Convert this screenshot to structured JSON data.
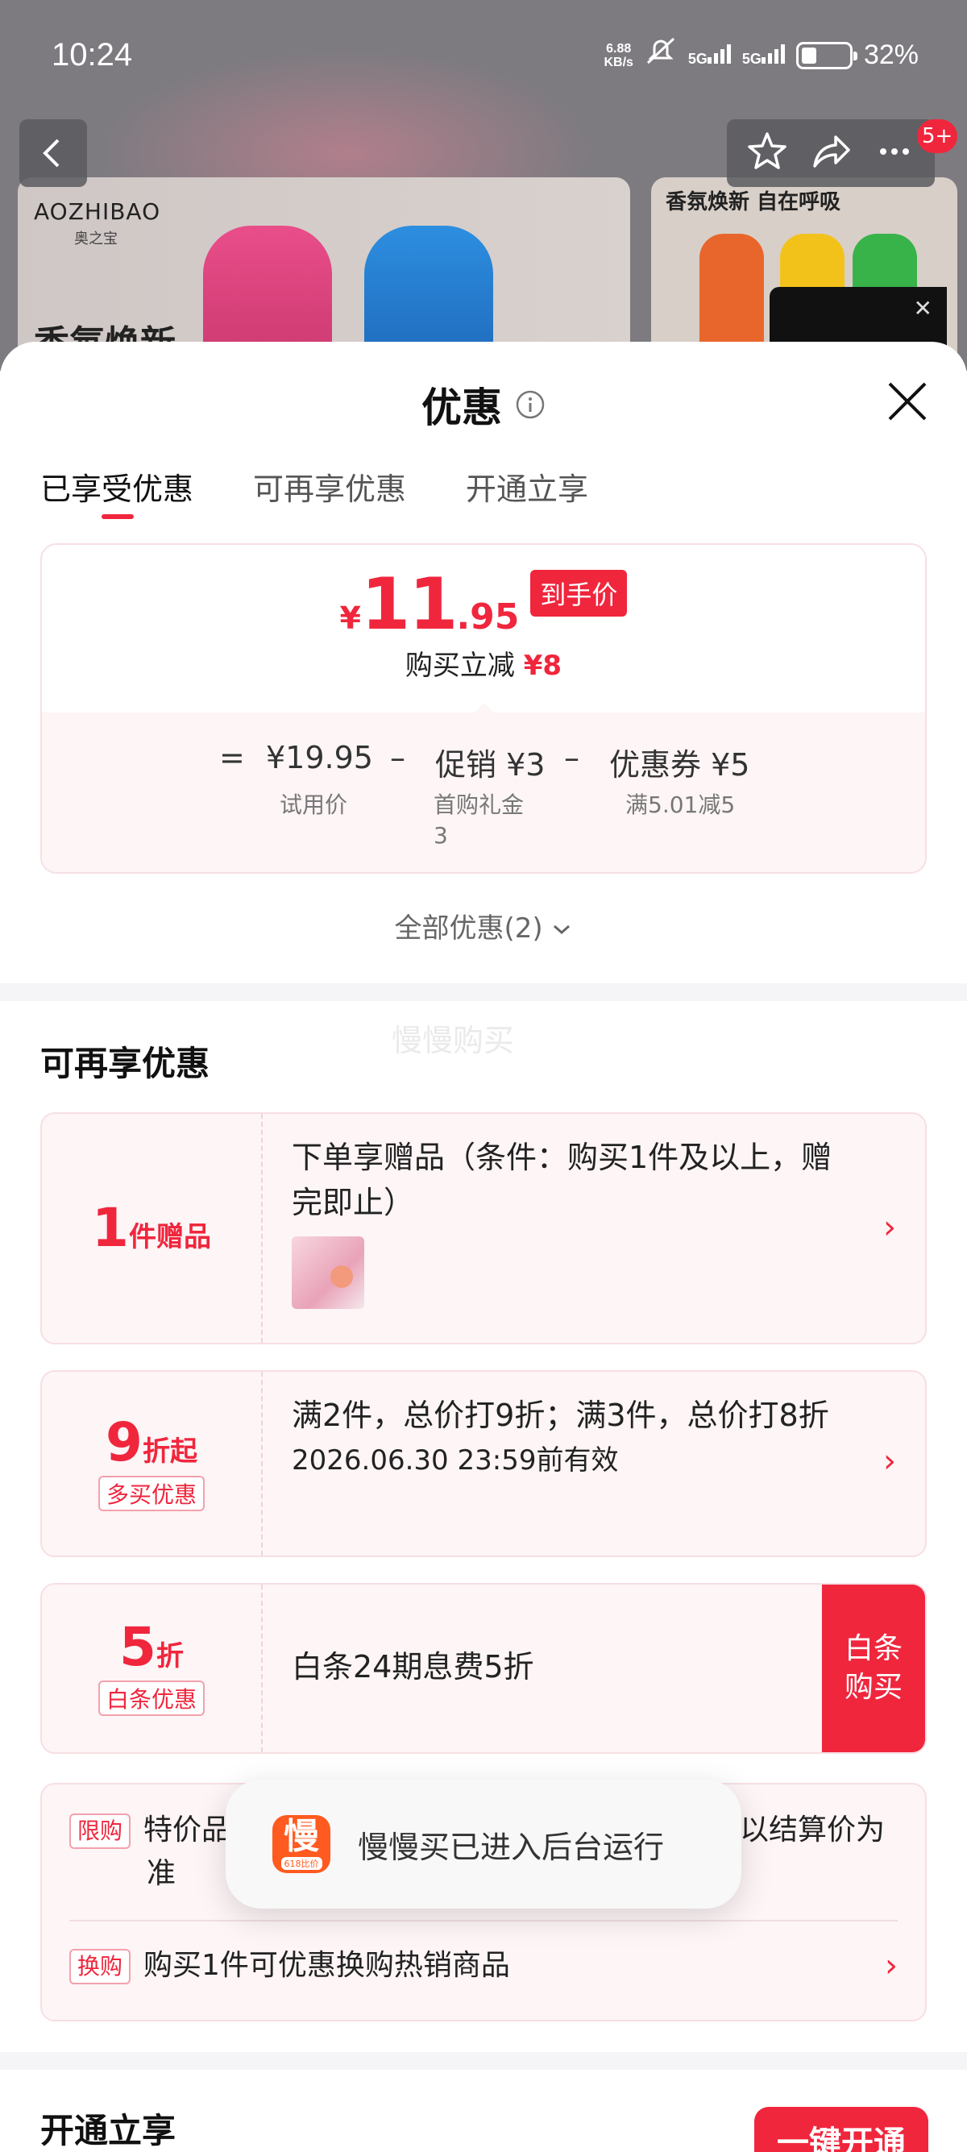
{
  "status_bar": {
    "time": "10:24",
    "net_speed_value": "6.88",
    "net_speed_unit": "KB/s",
    "signal1": "5G",
    "signal2": "5G",
    "battery": "32%"
  },
  "background_page": {
    "brand": "AOZHIBAO",
    "brand_sub": "奥之宝",
    "hero_text": "香氛焕新",
    "right_banner_title": "香氛焕新 自在呼吸",
    "badge": "5+"
  },
  "sheet": {
    "title": "优惠",
    "tabs": [
      "已享受优惠",
      "可再享优惠",
      "开通立享"
    ],
    "active_tab": 0
  },
  "price_card": {
    "yen": "¥",
    "price_int": "11",
    "price_dec": ".95",
    "tag": "到手价",
    "desc_prefix": "购买立减",
    "desc_amount": "¥8",
    "calc": {
      "eq": "=",
      "base": "¥19.95",
      "minus1": "–",
      "promo": "促销 ¥3",
      "minus2": "–",
      "coupon": "优惠券 ¥5",
      "base_label": "试用价",
      "promo_label_1": "首购礼金",
      "promo_label_2": "3",
      "coupon_label": "满5.01减5"
    }
  },
  "all_offers": "全部优惠(2)",
  "watermark": "慢慢购买",
  "more_offers": {
    "title": "可再享优惠",
    "gift": {
      "num": "1",
      "unit": "件赠品",
      "text": "下单享赠品（条件：购买1件及以上，赠完即止）"
    },
    "discount": {
      "num": "9",
      "unit": "折起",
      "tag": "多买优惠",
      "text": "满2件，总价打9折；满3件，总价打8折",
      "valid": "2026.06.30 23:59前有效"
    },
    "baitiao": {
      "num": "5",
      "unit": "折",
      "tag": "白条优惠",
      "text": "白条24期息费5折",
      "buy_button": "白条购买"
    },
    "limited": {
      "badge1": "限购",
      "text1_start": "特价品",
      "text1_end": "以结算价为",
      "text1_wrap": "准",
      "badge2": "换购",
      "text2": "购买1件可优惠换购热销商品"
    }
  },
  "open_section": {
    "title": "开通立享",
    "button": "一键开通"
  },
  "toast": {
    "icon_char": "慢",
    "icon_sub": "618比价",
    "text": "慢慢买已进入后台运行"
  },
  "colors": {
    "accent": "#f0263d",
    "card_bg": "#fdf5f6",
    "card_border": "#f7dfe3"
  }
}
